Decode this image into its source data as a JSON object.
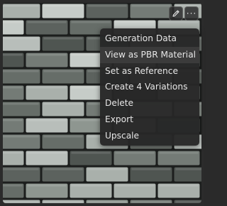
{
  "toolbar": {
    "edit_icon": "pencil-icon",
    "more_icon": "ellipsis-icon",
    "more_glyph": "···"
  },
  "context_menu": {
    "items": [
      {
        "label": "Generation Data"
      },
      {
        "label": "View as PBR Material",
        "highlighted": true
      },
      {
        "label": "Set as Reference"
      },
      {
        "label": "Create 4 Variations"
      },
      {
        "label": "Delete"
      },
      {
        "label": "Export"
      },
      {
        "label": "Upscale"
      }
    ]
  },
  "colors": {
    "menu_bg": "#262626",
    "menu_highlight": "#3b3b3b",
    "menu_text": "#e6e6e6",
    "brick_light": "#c6ccc8",
    "brick_mid": "#8e9690",
    "brick_dark": "#4a504c",
    "mortar": "#1c1e1d"
  }
}
